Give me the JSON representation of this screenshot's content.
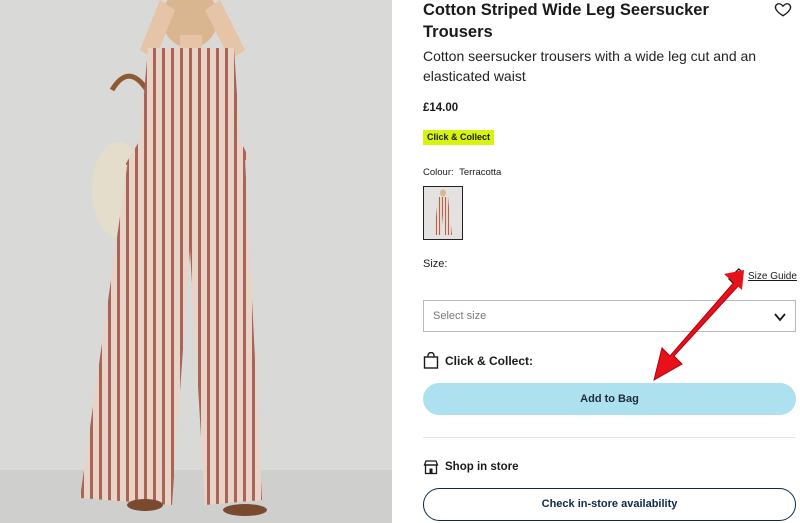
{
  "product": {
    "title": "Cotton Striped Wide Leg Seersucker Trousers",
    "description": "Cotton seersucker trousers with a wide leg cut and an elasticated waist",
    "price": "£14.00",
    "badge": "Click & Collect",
    "colour_label": "Colour:",
    "colour_value": "Terracotta"
  },
  "size": {
    "label": "Size:",
    "guide_label": "Size Guide",
    "select_placeholder": "Select size"
  },
  "actions": {
    "click_collect_label": "Click & Collect:",
    "add_to_bag": "Add to Bag",
    "shop_in_store": "Shop in store",
    "check_store": "Check in-store availability"
  },
  "icons": {
    "wishlist": "heart-icon",
    "size_guide": "ruler-icon",
    "dropdown": "chevron-down-icon",
    "bag": "shopping-bag-icon",
    "store": "store-icon"
  },
  "colors": {
    "badge_bg": "#d7f40f",
    "primary_button": "#aee1f0",
    "outline_button": "#0d2b45",
    "annotation_arrow": "#e8111a"
  }
}
